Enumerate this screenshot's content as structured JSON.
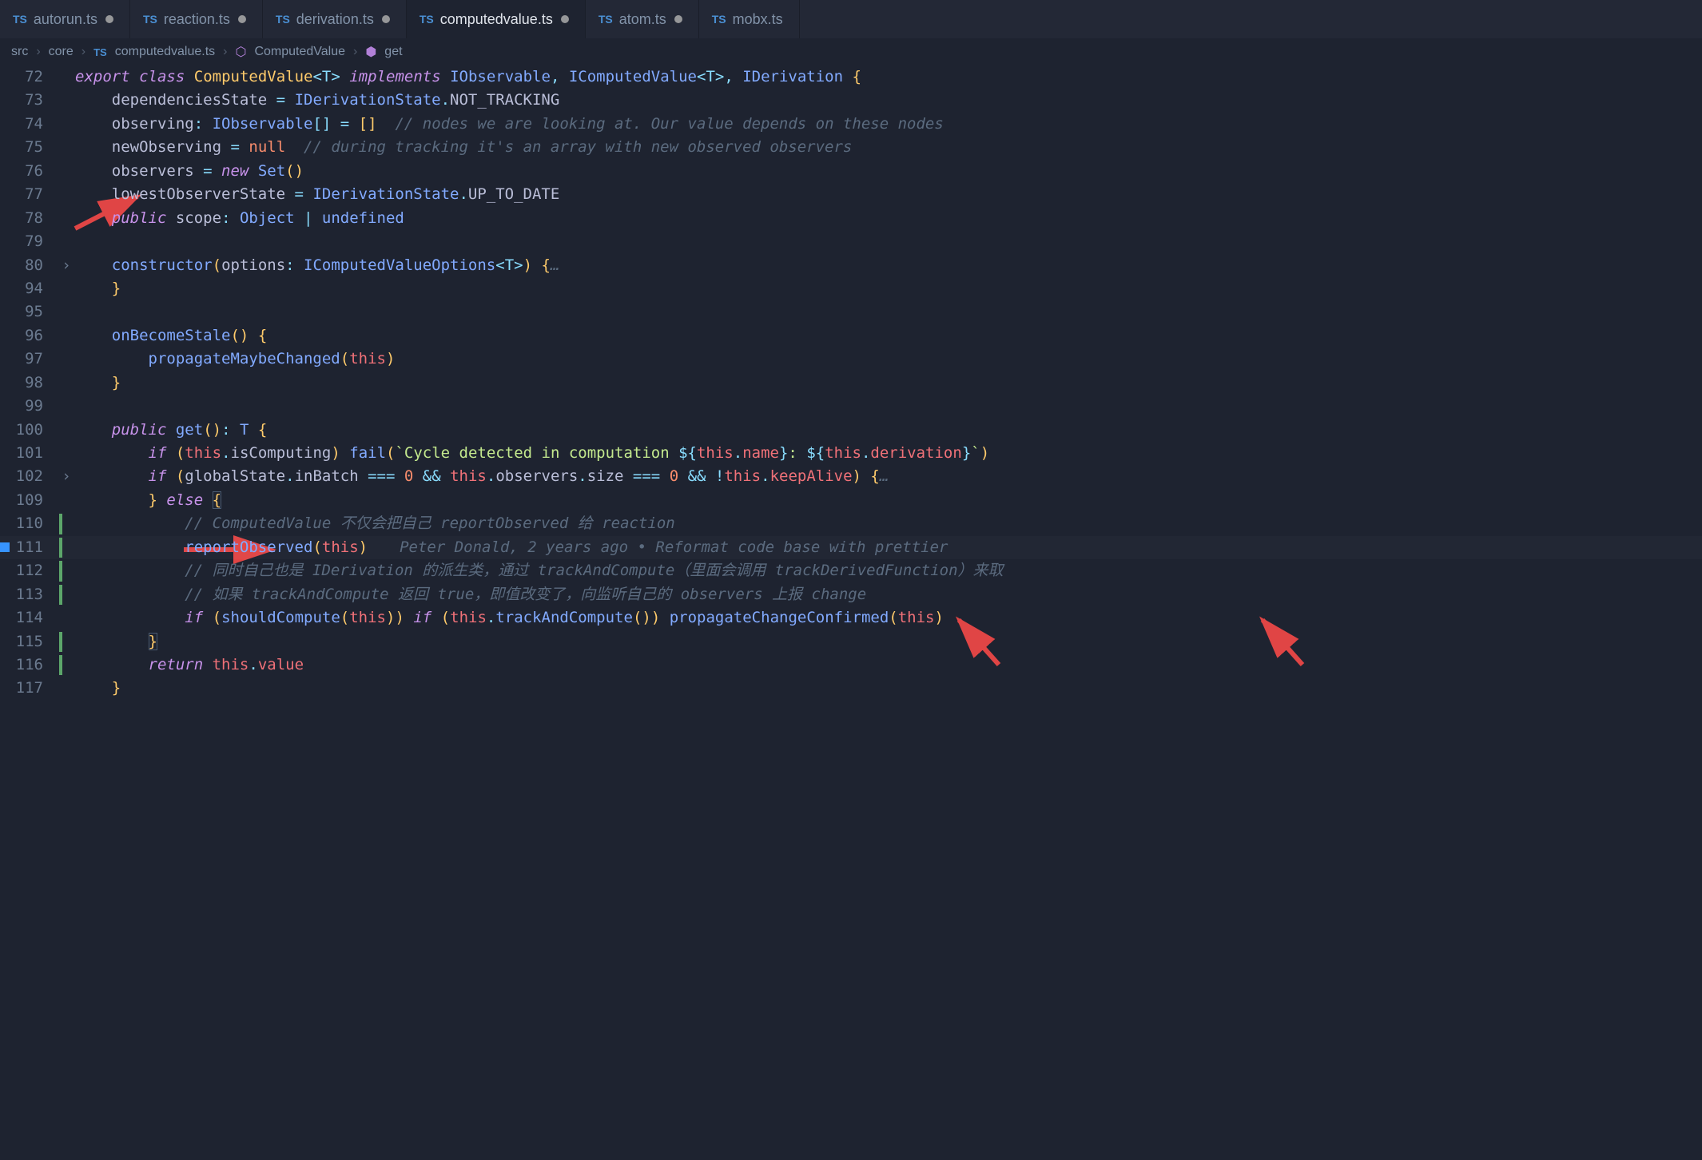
{
  "window": {
    "title_file": "computedvalue.ts",
    "title_repo": "mobx"
  },
  "tabs": [
    {
      "label": "autorun.ts",
      "dirty": true,
      "active": false
    },
    {
      "label": "reaction.ts",
      "dirty": true,
      "active": false
    },
    {
      "label": "derivation.ts",
      "dirty": true,
      "active": false
    },
    {
      "label": "computedvalue.ts",
      "dirty": true,
      "active": true
    },
    {
      "label": "atom.ts",
      "dirty": true,
      "active": false
    },
    {
      "label": "mobx.ts",
      "dirty": false,
      "active": false
    }
  ],
  "breadcrumb": {
    "parts": [
      "src",
      "core",
      "computedvalue.ts",
      "ComputedValue",
      "get"
    ]
  },
  "line_numbers": [
    "72",
    "73",
    "74",
    "75",
    "76",
    "77",
    "78",
    "79",
    "80",
    "94",
    "95",
    "96",
    "97",
    "98",
    "99",
    "100",
    "101",
    "102",
    "109",
    "110",
    "111",
    "112",
    "113",
    "114",
    "115",
    "116",
    "117"
  ],
  "code": {
    "l72": {
      "export": "export",
      "class": "class",
      "name": "ComputedValue",
      "tp": "<T>",
      "impl": "implements",
      "i1": "IObservable",
      "i2": "IComputedValue",
      "tp2": "<T>",
      "i3": "IDerivation",
      "ob": "{"
    },
    "l73": {
      "prop": "dependenciesState",
      "eq": " = ",
      "v": "IDerivationState",
      "dot": ".",
      "m": "NOT_TRACKING"
    },
    "l74": {
      "prop": "observing",
      "col": ": ",
      "ty": "IObservable",
      "arr": "[]",
      "eq": " = ",
      "v": "[]",
      "cm": "// nodes we are looking at. Our value depends on these nodes"
    },
    "l75": {
      "prop": "newObserving",
      "eq": " = ",
      "v": "null",
      "cm": "// during tracking it's an array with new observed observers"
    },
    "l76": {
      "prop": "observers",
      "eq": " = ",
      "new": "new",
      "set": "Set",
      "p": "()"
    },
    "l77": {
      "prop": "lowestObserverState",
      "eq": " = ",
      "v": "IDerivationState",
      "dot": ".",
      "m": "UP_TO_DATE"
    },
    "l78": {
      "pub": "public",
      "prop": "scope",
      "col": ": ",
      "ty": "Object",
      "pipe": " | ",
      "undef": "undefined"
    },
    "l80": {
      "fn": "constructor",
      "op": "(",
      "arg": "options",
      "col": ": ",
      "ty": "IComputedValueOptions",
      "tp": "<T>",
      "cp": ")",
      "ob": " {",
      "dots": "…"
    },
    "l94": {
      "cb": "}"
    },
    "l96": {
      "fn": "onBecomeStale",
      "p": "()",
      "ob": " {"
    },
    "l97": {
      "fn": "propagateMaybeChanged",
      "op": "(",
      "this": "this",
      "cp": ")"
    },
    "l98": {
      "cb": "}"
    },
    "l100": {
      "pub": "public",
      "fn": "get",
      "p": "()",
      "col": ": ",
      "ty": "T",
      "ob": " {"
    },
    "l101": {
      "if": "if",
      "op": " (",
      "this": "this",
      "dot": ".",
      "prop": "isComputing",
      "cp": ") ",
      "fn": "fail",
      "op2": "(",
      "tick": "`",
      "s1": "Cycle detected in computation ",
      "d1": "${",
      "this2": "this",
      "dot2": ".",
      "name": "name",
      "d1e": "}",
      "s2": ": ",
      "d2": "${",
      "this3": "this",
      "dot3": ".",
      "der": "derivation",
      "d2e": "}",
      "tick2": "`",
      "cp2": ")"
    },
    "l102": {
      "if": "if",
      "op": " (",
      "gs": "globalState",
      "dot": ".",
      "prop": "inBatch",
      "eq": " === ",
      "z": "0",
      "amp": " && ",
      "this": "this",
      "dot2": ".",
      "obs": "observers",
      "dot3": ".",
      "size": "size",
      "eq2": " === ",
      "z2": "0",
      "amp2": " && ",
      "not": "!",
      "this2": "this",
      "dot4": ".",
      "ka": "keepAlive",
      "cp": ")",
      " ob": " {",
      "dots": "…"
    },
    "l109": {
      "cb": "}",
      "else": " else ",
      "ob": "{"
    },
    "l110": {
      "cm": "// ComputedValue 不仅会把自己 reportObserved 给 reaction"
    },
    "l111": {
      "fn": "reportObserved",
      "op": "(",
      "this": "this",
      "cp": ")",
      "blame": "Peter Donald, 2 years ago • Reformat code base with prettier"
    },
    "l112": {
      "cm": "// 同时自己也是 IDerivation 的派生类，通过 trackAndCompute（里面会调用 trackDerivedFunction）来取"
    },
    "l113": {
      "cm": "// 如果 trackAndCompute 返回 true，即值改变了，向监听自己的 observers 上报 change"
    },
    "l114": {
      "if": "if",
      "op": " (",
      "fn": "shouldCompute",
      "op2": "(",
      "this": "this",
      "cp": ")",
      "cp2": ")",
      " if2": " if ",
      "op3": "(",
      "this2": "this",
      "dot": ".",
      "tac": "trackAndCompute",
      "p": "()",
      "cp3": ")",
      " ": " ",
      "fn2": "propagateChangeConfirmed",
      "op4": "(",
      "this3": "this",
      "cp4": ")"
    },
    "l115": {
      "cb": "}"
    },
    "l116": {
      "ret": "return",
      "sp": " ",
      "this": "this",
      "dot": ".",
      "val": "value"
    },
    "l117": {
      "cb": "}"
    }
  }
}
